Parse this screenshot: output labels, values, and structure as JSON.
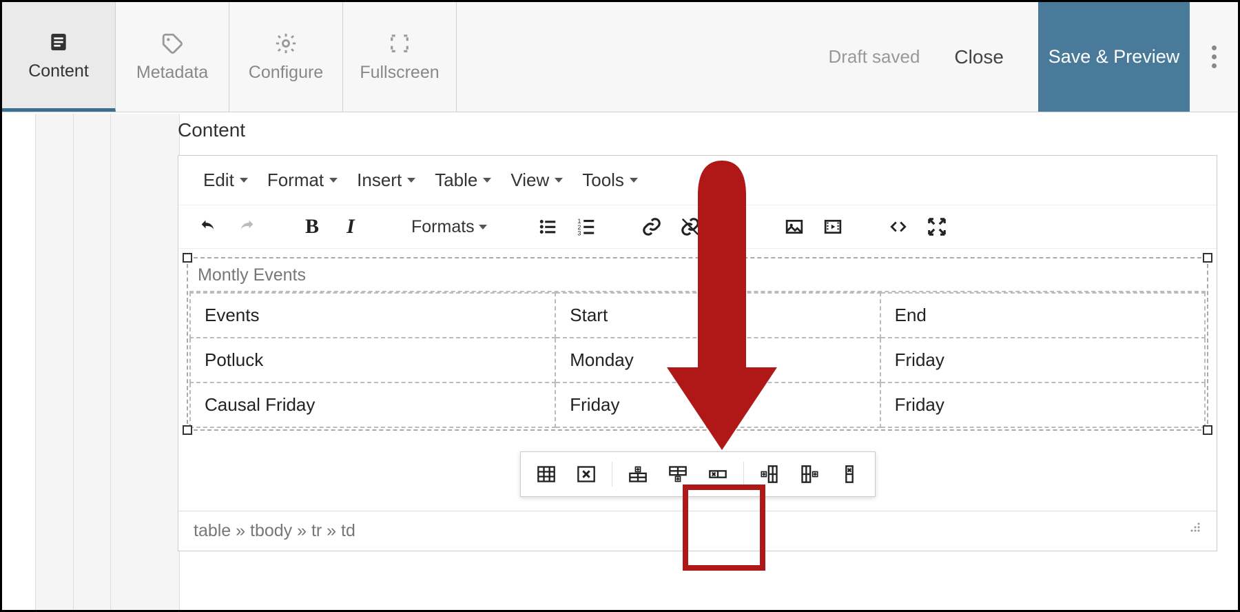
{
  "topbar": {
    "tabs": [
      {
        "label": "Content",
        "icon": "content-icon"
      },
      {
        "label": "Metadata",
        "icon": "tag-icon"
      },
      {
        "label": "Configure",
        "icon": "gear-icon"
      },
      {
        "label": "Fullscreen",
        "icon": "fullscreen-icon"
      }
    ],
    "status": "Draft saved",
    "close": "Close",
    "save": "Save & Preview"
  },
  "section_label": "Content",
  "menubar": [
    "Edit",
    "Format",
    "Insert",
    "Table",
    "View",
    "Tools"
  ],
  "toolbar": {
    "formats_label": "Formats"
  },
  "table": {
    "caption": "Montly Events",
    "rows": [
      [
        "Events",
        "Start",
        "End"
      ],
      [
        "Potluck",
        "Monday",
        "Friday"
      ],
      [
        "Causal Friday",
        "Friday",
        "Friday"
      ]
    ]
  },
  "context_toolbar": {
    "buttons": [
      "table-properties-icon",
      "delete-table-icon",
      "insert-row-before-icon",
      "insert-row-after-icon",
      "delete-row-icon",
      "insert-col-before-icon",
      "insert-col-after-icon",
      "delete-col-icon"
    ]
  },
  "breadcrumb": "table » tbody » tr » td"
}
